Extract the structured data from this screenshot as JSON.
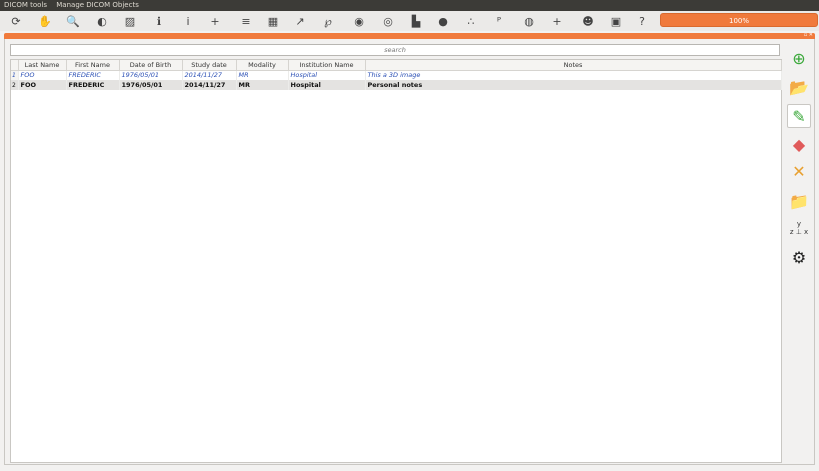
{
  "menu": {
    "dicom_tools": "DICOM tools",
    "manage": "Manage DICOM Objects"
  },
  "toolbar": {
    "icons": [
      {
        "name": "rotate-icon",
        "glyph": "⟳"
      },
      {
        "name": "pan-hand-icon",
        "glyph": "✋"
      },
      {
        "name": "zoom-icon",
        "glyph": "🔍"
      },
      {
        "name": "contrast-icon",
        "glyph": "◐"
      },
      {
        "name": "window-level-icon",
        "glyph": "▨"
      },
      {
        "name": "info-icon",
        "glyph": "ℹ"
      },
      {
        "name": "probe-icon",
        "glyph": "ⅰ"
      },
      {
        "name": "crosshair-icon",
        "glyph": "+"
      },
      {
        "name": "list-icon",
        "glyph": "≡"
      },
      {
        "name": "layout-grid-icon",
        "glyph": "▦"
      },
      {
        "name": "axes-icon",
        "glyph": "↗"
      },
      {
        "name": "lasso-icon",
        "glyph": "℘"
      },
      {
        "name": "sphere-icon",
        "glyph": "◉"
      },
      {
        "name": "surface-icon",
        "glyph": "◎"
      },
      {
        "name": "volume-icon",
        "glyph": "▙"
      },
      {
        "name": "ball-icon",
        "glyph": "●"
      },
      {
        "name": "points-icon",
        "glyph": "∴"
      },
      {
        "name": "landmarks-icon",
        "glyph": "ᴾ"
      },
      {
        "name": "fusion-icon",
        "glyph": "◍"
      },
      {
        "name": "cross-cursor-icon",
        "glyph": "+"
      },
      {
        "name": "2d-view-icon",
        "glyph": "☻"
      },
      {
        "name": "3d-view-icon",
        "glyph": "▣"
      },
      {
        "name": "help-icon",
        "glyph": "?"
      }
    ],
    "progress": "100%"
  },
  "search": {
    "placeholder": "search"
  },
  "table": {
    "headers": [
      "Last Name",
      "First Name",
      "Date of Birth",
      "Study date",
      "Modality",
      "Institution Name",
      "Notes"
    ],
    "rows": [
      {
        "num": "1",
        "last": "FOO",
        "first": "FREDERIC",
        "dob": "1976/05/01",
        "study": "2014/11/27",
        "modality": "MR",
        "institution": "Hospital",
        "notes": "This a 3D image"
      },
      {
        "num": "2",
        "last": "FOO",
        "first": "FREDERIC",
        "dob": "1976/05/01",
        "study": "2014/11/27",
        "modality": "MR",
        "institution": "Hospital",
        "notes": "Personal notes"
      }
    ]
  },
  "sidebar": {
    "icons": [
      {
        "name": "add-series-icon",
        "glyph": "⊕",
        "color": "#3aa83a"
      },
      {
        "name": "add-folder-icon",
        "glyph": "📂",
        "color": "#3aa83a"
      },
      {
        "name": "edit-notes-icon",
        "glyph": "✎",
        "color": "#3aa83a"
      },
      {
        "name": "eraser-icon",
        "glyph": "◆",
        "color": "#e05a5a"
      },
      {
        "name": "remove-folder-icon",
        "glyph": "✕",
        "color": "#e8a030"
      },
      {
        "name": "open-folder-icon",
        "glyph": "📁",
        "color": "#d9b030"
      },
      {
        "name": "axes-orientation-icon",
        "glyph": "⊥",
        "color": "#333333"
      },
      {
        "name": "settings-gear-icon",
        "glyph": "⚙",
        "color": "#222222"
      }
    ],
    "axes_labels": {
      "y": "y",
      "z": "z",
      "x": "x"
    }
  },
  "colors": {
    "accent": "#f07a3c",
    "link": "#2a4fb5"
  }
}
